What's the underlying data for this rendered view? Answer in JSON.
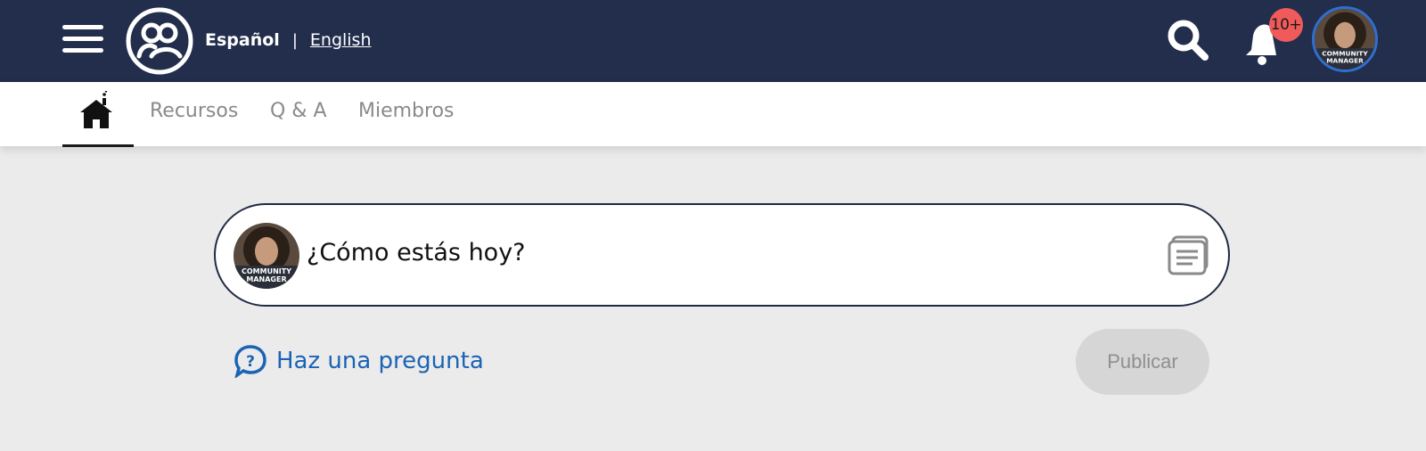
{
  "header": {
    "menu_icon": "hamburger-menu-icon",
    "logo_icon": "community-logo-icon",
    "languages": {
      "active": "Español",
      "separator": "|",
      "other": "English"
    },
    "search_icon": "search-icon",
    "bell_icon": "bell-icon",
    "notification_count": "10+",
    "avatar_caption_line1": "COMMUNITY",
    "avatar_caption_line2": "MANAGER"
  },
  "nav": {
    "home_icon": "home-icon",
    "items": [
      {
        "label": "Recursos"
      },
      {
        "label": "Q & A"
      },
      {
        "label": "Miembros"
      }
    ]
  },
  "composer": {
    "prompt": "¿Cómo estás hoy?",
    "attach_icon": "document-icon",
    "avatar_caption_line1": "COMMUNITY",
    "avatar_caption_line2": "MANAGER"
  },
  "actions": {
    "ask_icon": "question-bubble-icon",
    "ask_label": "Haz una pregunta",
    "publish_label": "Publicar"
  },
  "colors": {
    "header_bg": "#222e4c",
    "page_bg": "#ebebeb",
    "link_blue": "#1b63b5",
    "badge_red": "#f05a5a",
    "publish_disabled_bg": "#d6d6d6"
  }
}
